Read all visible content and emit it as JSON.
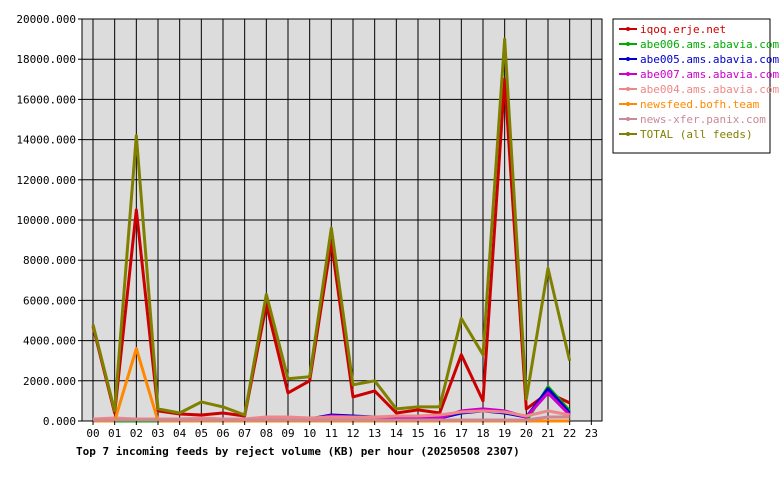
{
  "chart_data": {
    "type": "line",
    "title": "Top 7 incoming feeds by reject volume (KB) per hour (20250508 2307)",
    "xlabel": "",
    "ylabel": "",
    "categories": [
      "00",
      "01",
      "02",
      "03",
      "04",
      "05",
      "06",
      "07",
      "08",
      "09",
      "10",
      "11",
      "12",
      "13",
      "14",
      "15",
      "16",
      "17",
      "18",
      "19",
      "20",
      "21",
      "22",
      "23"
    ],
    "y_tick_labels": [
      "0.000",
      "2000.000",
      "4000.000",
      "6000.000",
      "8000.000",
      "10000.000",
      "12000.000",
      "14000.000",
      "16000.000",
      "18000.000",
      "20000.000"
    ],
    "ylim": [
      0,
      20000
    ],
    "grid": true,
    "legend_position": "right",
    "series": [
      {
        "name": "iqoq.erje.net",
        "color": "#cc0000",
        "values": [
          4700,
          400,
          10500,
          500,
          350,
          300,
          400,
          250,
          5800,
          1400,
          2000,
          8900,
          1200,
          1500,
          400,
          550,
          400,
          3300,
          1000,
          17000,
          600,
          1400,
          900,
          null
        ]
      },
      {
        "name": "abe006.ams.abavia.com",
        "color": "#00aa00",
        "values": [
          0,
          0,
          0,
          0,
          0,
          0,
          0,
          0,
          0,
          0,
          0,
          0,
          0,
          0,
          0,
          0,
          0,
          0,
          0,
          0,
          0,
          1700,
          500,
          null
        ]
      },
      {
        "name": "abe005.ams.abavia.com",
        "color": "#0000cc",
        "values": [
          50,
          50,
          50,
          50,
          50,
          50,
          50,
          50,
          50,
          50,
          100,
          300,
          250,
          200,
          100,
          150,
          150,
          400,
          500,
          400,
          200,
          1600,
          400,
          null
        ]
      },
      {
        "name": "abe007.ams.abavia.com",
        "color": "#cc00cc",
        "values": [
          50,
          50,
          50,
          50,
          50,
          50,
          50,
          50,
          50,
          50,
          100,
          250,
          200,
          150,
          100,
          150,
          150,
          500,
          600,
          500,
          200,
          1400,
          300,
          null
        ]
      },
      {
        "name": "abe004.ams.abavia.com",
        "color": "#ee8888",
        "values": [
          100,
          150,
          100,
          100,
          100,
          150,
          100,
          100,
          200,
          200,
          150,
          200,
          200,
          200,
          250,
          250,
          300,
          450,
          500,
          450,
          250,
          500,
          300,
          null
        ]
      },
      {
        "name": "newsfeed.bofh.team",
        "color": "#ff8800",
        "values": [
          0,
          0,
          3600,
          0,
          0,
          0,
          0,
          0,
          0,
          0,
          0,
          0,
          0,
          0,
          0,
          0,
          0,
          0,
          0,
          0,
          0,
          0,
          0,
          null
        ]
      },
      {
        "name": "news-xfer.panix.com",
        "color": "#cc8899",
        "values": [
          50,
          50,
          50,
          50,
          50,
          50,
          50,
          50,
          50,
          50,
          50,
          50,
          50,
          50,
          50,
          50,
          50,
          50,
          50,
          50,
          50,
          200,
          200,
          null
        ]
      },
      {
        "name": "TOTAL (all feeds)",
        "color": "#808000",
        "values": [
          4800,
          500,
          14200,
          600,
          400,
          950,
          700,
          300,
          6300,
          2100,
          2200,
          9600,
          1800,
          2000,
          600,
          700,
          700,
          5100,
          3300,
          19000,
          1100,
          7600,
          3000,
          null
        ]
      }
    ]
  }
}
